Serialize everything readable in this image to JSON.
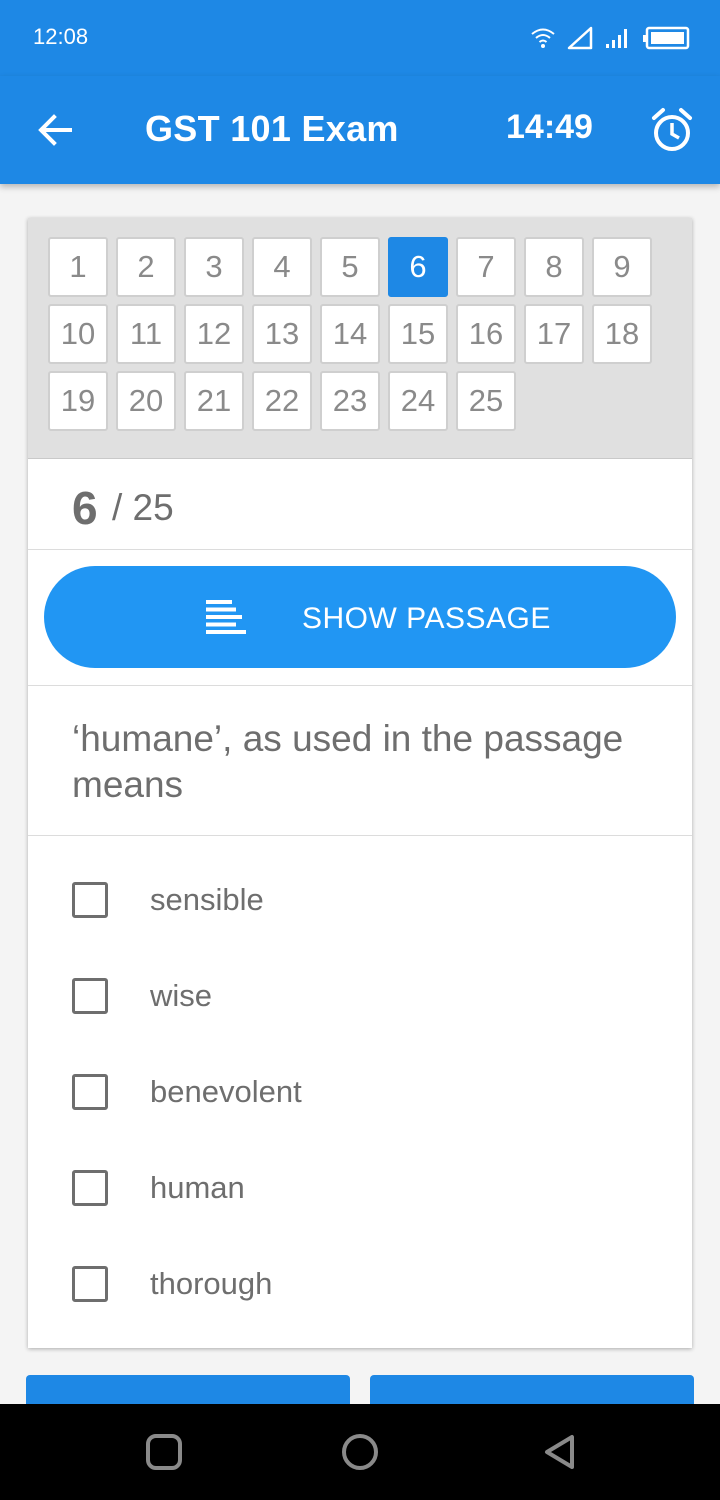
{
  "status_bar": {
    "time": "12:08",
    "icons": [
      "wifi-icon",
      "signal-triangle-icon",
      "signal-bars-icon",
      "battery-icon"
    ]
  },
  "app_bar": {
    "title": "GST 101 Exam",
    "timer": "14:49",
    "back_icon": "arrow-left-icon",
    "alarm_icon": "alarm-clock-icon"
  },
  "question_nav": {
    "numbers": [
      "1",
      "2",
      "3",
      "4",
      "5",
      "6",
      "7",
      "8",
      "9",
      "10",
      "11",
      "12",
      "13",
      "14",
      "15",
      "16",
      "17",
      "18",
      "19",
      "20",
      "21",
      "22",
      "23",
      "24",
      "25"
    ],
    "current": "6"
  },
  "counter": {
    "current": "6",
    "rest": "/ 25"
  },
  "passage_button": {
    "label": "SHOW PASSAGE",
    "icon": "text-lines-icon"
  },
  "question": {
    "text": "‘humane’, as used in the passage means"
  },
  "options": [
    {
      "label": "sensible",
      "checked": false
    },
    {
      "label": "wise",
      "checked": false
    },
    {
      "label": "benevolent",
      "checked": false
    },
    {
      "label": "human",
      "checked": false
    },
    {
      "label": "thorough",
      "checked": false
    }
  ],
  "colors": {
    "primary": "#1e88e5",
    "button": "#2196f3",
    "text": "#6e6e6e"
  },
  "system_nav": [
    "square-icon",
    "circle-icon",
    "triangle-back-icon"
  ]
}
